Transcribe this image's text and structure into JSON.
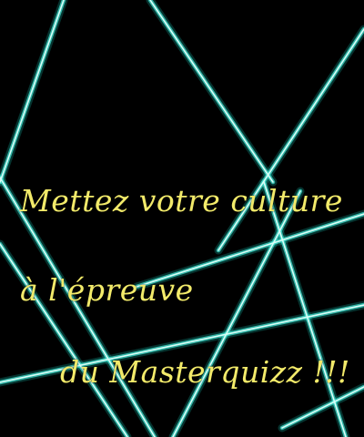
{
  "slogan": {
    "line1": "Mettez votre culture",
    "line2": "à l'épreuve",
    "line3": "du Masterquizz !!!"
  },
  "colors": {
    "background": "#000000",
    "laser_core": "#d9fff8",
    "laser_mid": "#3fe0cf",
    "laser_glow": "#16b7aa",
    "text": "#f2ea6a"
  }
}
